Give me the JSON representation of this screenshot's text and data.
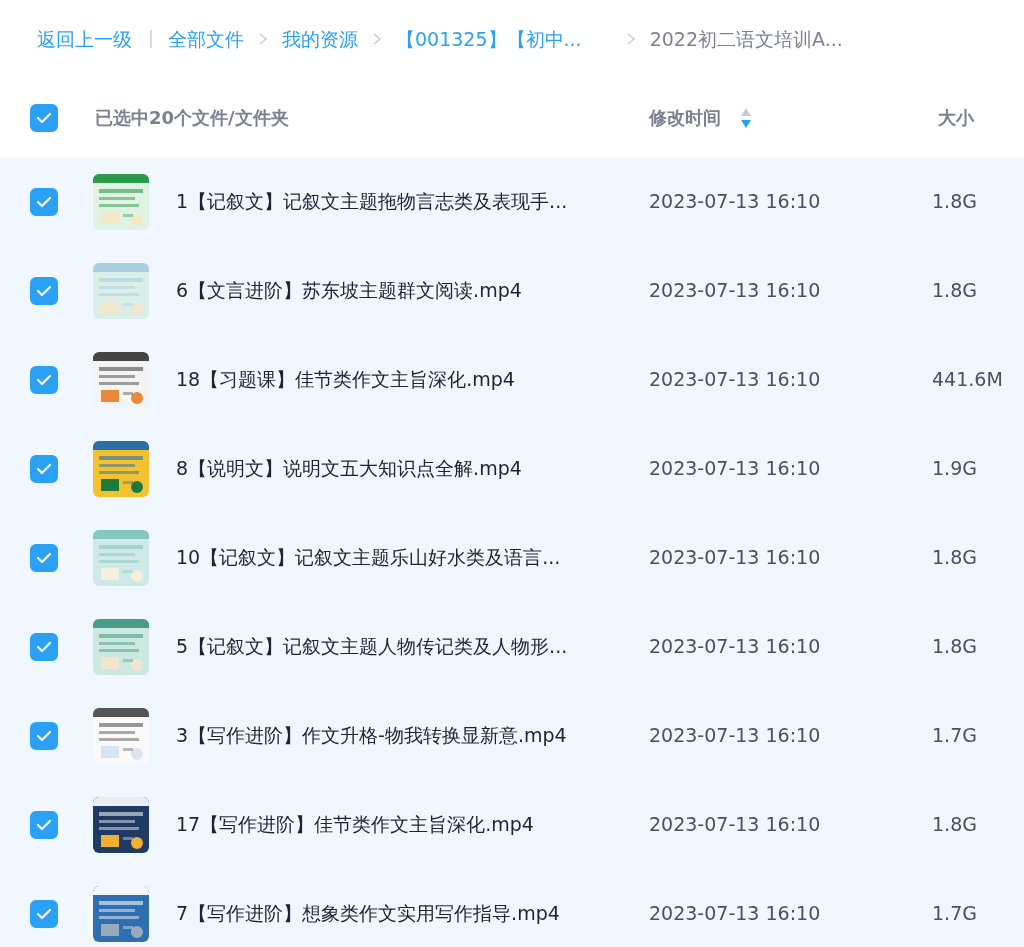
{
  "breadcrumb": [
    {
      "label": "返回上一级",
      "kind": "link"
    },
    {
      "label": "全部文件",
      "kind": "link"
    },
    {
      "label": "我的资源",
      "kind": "link"
    },
    {
      "label": "【001325】【初中...",
      "kind": "link"
    },
    {
      "label": "2022初二语文培训A...",
      "kind": "current"
    }
  ],
  "header": {
    "checked": true,
    "selection": "已选中20个文件/文件夹",
    "columns": [
      "修改时间",
      "大小"
    ]
  },
  "rows": [
    {
      "name": "1【记叙文】记叙文主题拖物言志类及表现手...",
      "modified": "2023-07-13 16:10",
      "size": "1.8G",
      "checked": true
    },
    {
      "name": "6【文言进阶】苏东坡主题群文阅读.mp4",
      "modified": "2023-07-13 16:10",
      "size": "1.8G",
      "checked": true
    },
    {
      "name": "18【习题课】佳节类作文主旨深化.mp4",
      "modified": "2023-07-13 16:10",
      "size": "441.6M",
      "checked": true
    },
    {
      "name": "8【说明文】说明文五大知识点全解.mp4",
      "modified": "2023-07-13 16:10",
      "size": "1.9G",
      "checked": true
    },
    {
      "name": "10【记叙文】记叙文主题乐山好水类及语言...",
      "modified": "2023-07-13 16:10",
      "size": "1.8G",
      "checked": true
    },
    {
      "name": "5【记叙文】记叙文主题人物传记类及人物形...",
      "modified": "2023-07-13 16:10",
      "size": "1.8G",
      "checked": true
    },
    {
      "name": "3【写作进阶】作文升格-物我转换显新意.mp4",
      "modified": "2023-07-13 16:10",
      "size": "1.7G",
      "checked": true
    },
    {
      "name": "17【写作进阶】佳节类作文主旨深化.mp4",
      "modified": "2023-07-13 16:10",
      "size": "1.8G",
      "checked": true
    },
    {
      "name": "7【写作进阶】想象类作文实用写作指导.mp4",
      "modified": "2023-07-13 16:10",
      "size": "1.7G",
      "checked": true
    }
  ]
}
